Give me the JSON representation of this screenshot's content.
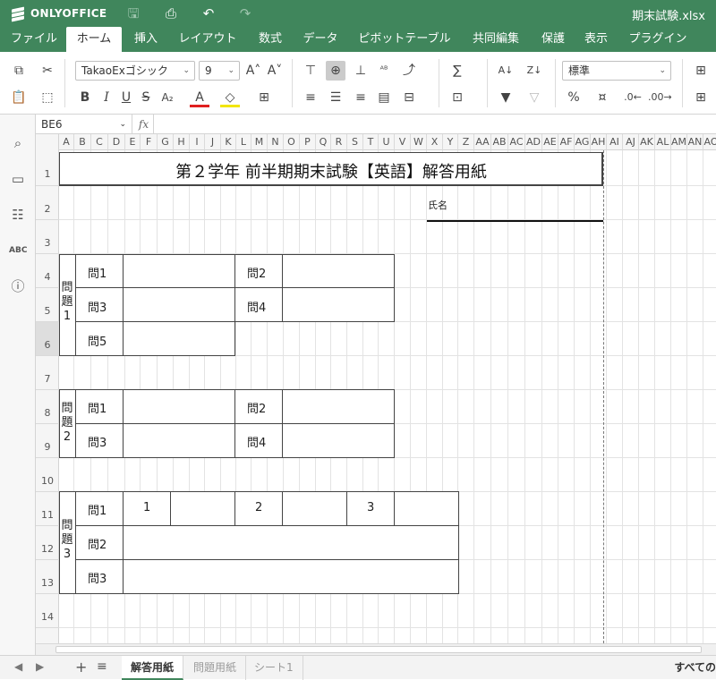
{
  "app": {
    "brand": "ONLYOFFICE",
    "filename": "期末試験.xlsx",
    "accent": "#40865c"
  },
  "menu_tabs": [
    "ファイル",
    "ホーム",
    "挿入",
    "レイアウト",
    "数式",
    "データ",
    "ピボットテーブル",
    "共同編集",
    "保護",
    "表示",
    "プラグイン"
  ],
  "active_tab": "ホーム",
  "toolbar": {
    "font_name": "TakaoExゴシック",
    "font_size": "9",
    "number_format": "標準"
  },
  "formula_bar": {
    "name_box": "BE6",
    "fx_label": "fx",
    "formula": ""
  },
  "columns": [
    "A",
    "B",
    "C",
    "D",
    "E",
    "F",
    "G",
    "H",
    "I",
    "J",
    "K",
    "L",
    "M",
    "N",
    "O",
    "P",
    "Q",
    "R",
    "S",
    "T",
    "U",
    "V",
    "W",
    "X",
    "Y",
    "Z",
    "AA",
    "AB",
    "AC",
    "AD",
    "AE",
    "AF",
    "AG",
    "AH",
    "AI",
    "AJ",
    "AK",
    "AL",
    "AM",
    "AN",
    "AO"
  ],
  "rows": [
    "1",
    "2",
    "3",
    "4",
    "5",
    "6",
    "7",
    "8",
    "9",
    "10",
    "11",
    "12",
    "13",
    "14"
  ],
  "selected_row": "6",
  "sheet": {
    "title": "第２学年  前半期期末試験【英語】解答用紙",
    "name_label": "氏名",
    "section1_label": "問題1",
    "section2_label": "問題2",
    "section3_label": "問題3",
    "q1": "問1",
    "q2": "問2",
    "q3": "問3",
    "q4": "問4",
    "q5": "問5",
    "s3_sub1": "1",
    "s3_sub2": "2",
    "s3_sub3": "3"
  },
  "sheet_tabs": [
    "解答用紙",
    "問題用紙",
    "シート1"
  ],
  "active_sheet": "解答用紙",
  "status_right": "すべての"
}
